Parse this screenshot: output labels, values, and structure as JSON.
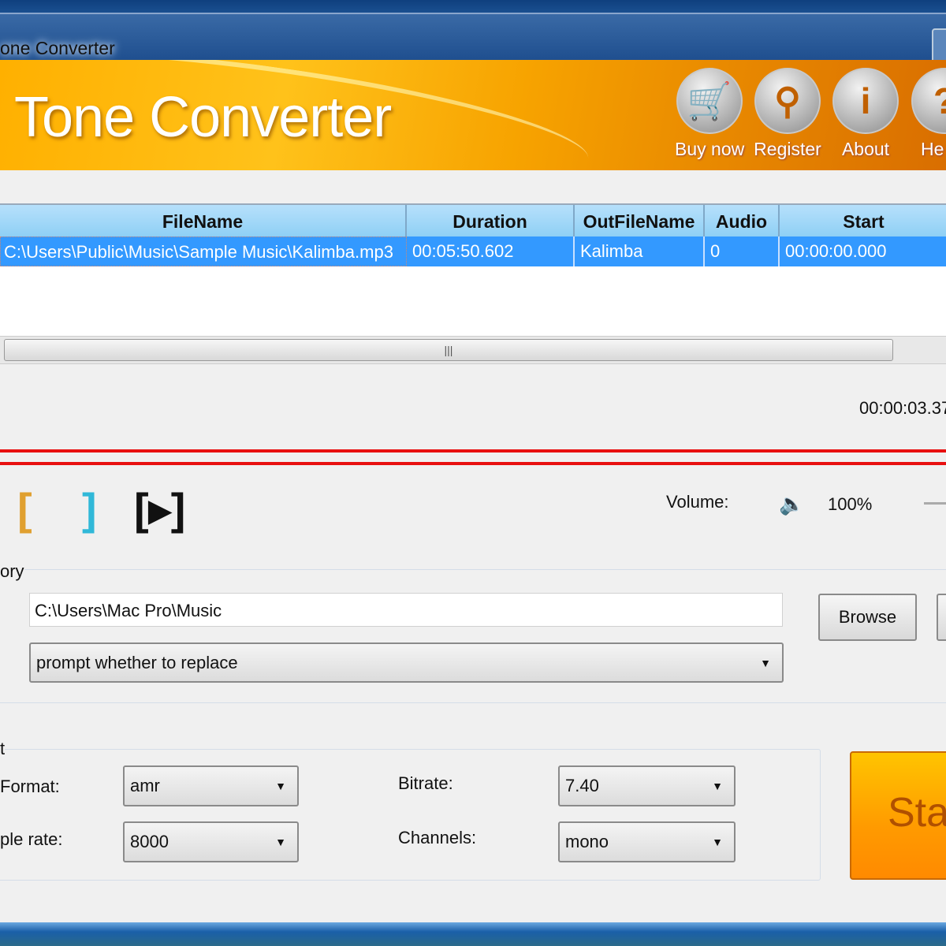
{
  "window": {
    "title": "one Converter"
  },
  "banner": {
    "app_title": "Tone Converter",
    "buttons": [
      {
        "label": "Buy now",
        "icon": "cart-icon"
      },
      {
        "label": "Register",
        "icon": "key-icon"
      },
      {
        "label": "About",
        "icon": "info-icon"
      },
      {
        "label": "He",
        "icon": "help-icon"
      }
    ]
  },
  "table": {
    "columns": [
      "FileName",
      "Duration",
      "OutFileName",
      "Audio",
      "Start"
    ],
    "rows": [
      [
        "C:\\Users\\Public\\Music\\Sample Music\\Kalimba.mp3",
        "00:05:50.602",
        "Kalimba",
        "0",
        "00:00:00.000"
      ]
    ]
  },
  "player": {
    "time": "00:00:03.37",
    "volume_label": "Volume:",
    "volume": "100%"
  },
  "output": {
    "group_label": "ory",
    "directory": "C:\\Users\\Mac Pro\\Music",
    "browse_label": "Browse",
    "overwrite": "prompt whether to replace"
  },
  "settings": {
    "group_label": "t",
    "format_label": "Format:",
    "format": "amr",
    "bitrate_label": "Bitrate:",
    "bitrate": "7.40",
    "samplerate_label": "ple rate:",
    "samplerate": "8000",
    "channels_label": "Channels:",
    "channels": "mono"
  },
  "start_label": "Sta",
  "colors": {
    "banner": "#ffb000",
    "selection": "#3399ff",
    "marker_red": "#e81010",
    "start": "#ff9a00"
  }
}
